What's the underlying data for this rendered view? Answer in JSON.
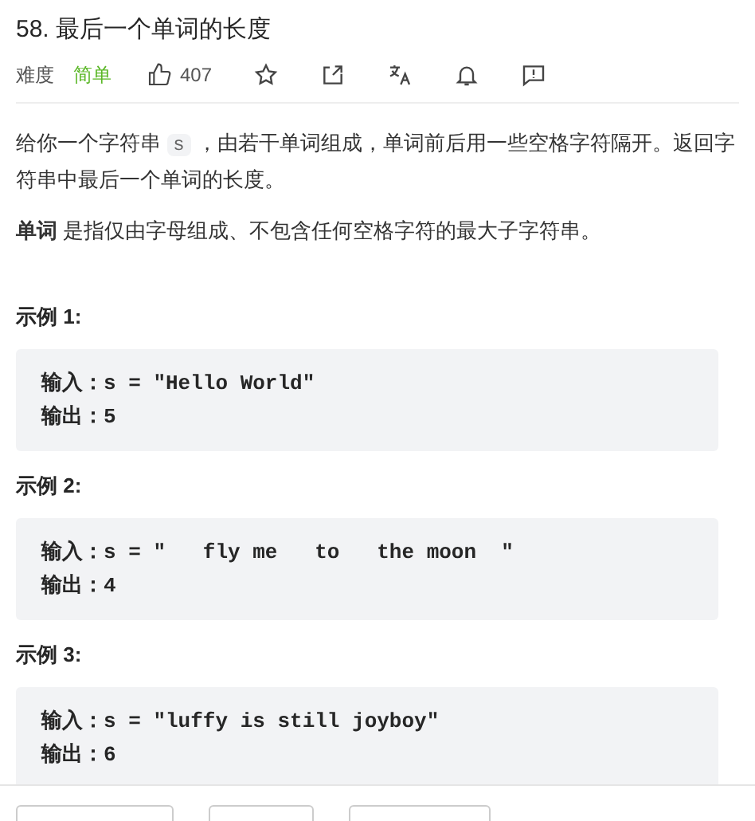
{
  "title": "58. 最后一个单词的长度",
  "meta": {
    "difficulty_label": "难度",
    "difficulty": "简单",
    "likes": "407"
  },
  "description": {
    "parts": [
      {
        "kind": "text",
        "text": "给你一个字符串 "
      },
      {
        "kind": "code",
        "text": "s"
      },
      {
        "kind": "text",
        "text": " ，由若干单词组成，单词前后用一些空格字符隔开。返回字符串中最后一个单词的长度。"
      }
    ]
  },
  "definition": "**单词** 是指仅由字母组成、不包含任何空格字符的最大子字符串。",
  "examples": [
    {
      "heading": "示例 1:",
      "lines": [
        "输入：s = \"Hello World\"",
        "输出：5"
      ]
    },
    {
      "heading": "示例 2:",
      "lines": [
        "输入：s = \"   fly me   to   the moon  \"",
        "输出：4"
      ]
    },
    {
      "heading": "示例 3:",
      "lines": [
        "输入：s = \"luffy is still joyboy\"",
        "输出：6"
      ]
    }
  ]
}
